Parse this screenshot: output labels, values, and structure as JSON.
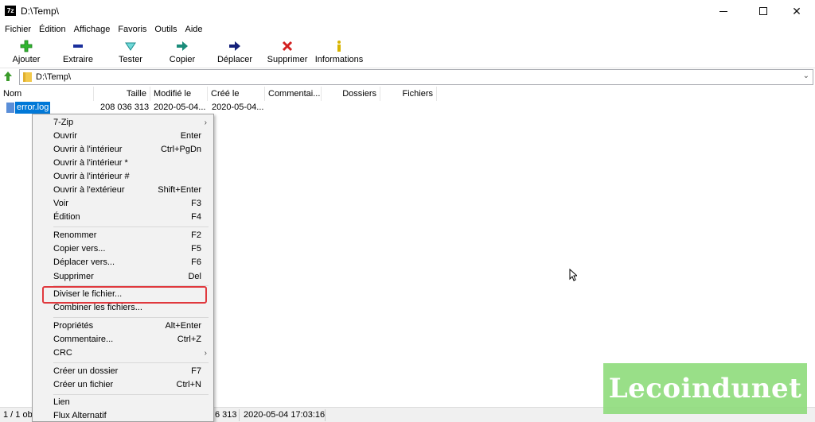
{
  "window": {
    "title": "D:\\Temp\\",
    "app_icon_text": "7z"
  },
  "menu": [
    "Fichier",
    "Édition",
    "Affichage",
    "Favoris",
    "Outils",
    "Aide"
  ],
  "toolbar": [
    {
      "label": "Ajouter",
      "icon": "add-icon",
      "color": "#2fb52f"
    },
    {
      "label": "Extraire",
      "icon": "extract-icon",
      "color": "#1a2f9c"
    },
    {
      "label": "Tester",
      "icon": "test-icon",
      "color": "#2fb5b5"
    },
    {
      "label": "Copier",
      "icon": "copy-icon",
      "color": "#1a8c7a"
    },
    {
      "label": "Déplacer",
      "icon": "move-icon",
      "color": "#14207a"
    },
    {
      "label": "Supprimer",
      "icon": "delete-icon",
      "color": "#d32020"
    },
    {
      "label": "Informations",
      "icon": "info-icon",
      "color": "#d8b400"
    }
  ],
  "address": {
    "path": "D:\\Temp\\"
  },
  "columns": [
    "Nom",
    "Taille",
    "Modifié le",
    "Créé le",
    "Commentai...",
    "Dossiers",
    "Fichiers"
  ],
  "files": [
    {
      "name": "error.log",
      "size": "208 036 313",
      "modified": "2020-05-04...",
      "created": "2020-05-04..."
    }
  ],
  "context_menu": {
    "items": [
      {
        "label": "7-Zip",
        "shortcut": "",
        "submenu": true
      },
      {
        "label": "Ouvrir",
        "shortcut": "Enter"
      },
      {
        "label": "Ouvrir à l'intérieur",
        "shortcut": "Ctrl+PgDn"
      },
      {
        "label": "Ouvrir à l'intérieur *",
        "shortcut": ""
      },
      {
        "label": "Ouvrir à l'intérieur #",
        "shortcut": ""
      },
      {
        "label": "Ouvrir à l'extérieur",
        "shortcut": "Shift+Enter"
      },
      {
        "label": "Voir",
        "shortcut": "F3"
      },
      {
        "label": "Édition",
        "shortcut": "F4"
      },
      {
        "label": "Renommer",
        "shortcut": "F2"
      },
      {
        "label": "Copier vers...",
        "shortcut": "F5"
      },
      {
        "label": "Déplacer vers...",
        "shortcut": "F6"
      },
      {
        "label": "Supprimer",
        "shortcut": "Del"
      },
      {
        "label": "Diviser le fichier...",
        "shortcut": ""
      },
      {
        "label": "Combiner les fichiers...",
        "shortcut": ""
      },
      {
        "label": "Propriétés",
        "shortcut": "Alt+Enter"
      },
      {
        "label": "Commentaire...",
        "shortcut": "Ctrl+Z"
      },
      {
        "label": "CRC",
        "shortcut": "",
        "submenu": true
      },
      {
        "label": "Créer un dossier",
        "shortcut": "F7"
      },
      {
        "label": "Créer un fichier",
        "shortcut": "Ctrl+N"
      },
      {
        "label": "Lien",
        "shortcut": ""
      },
      {
        "label": "Flux Alternatif",
        "shortcut": ""
      }
    ],
    "highlighted": "Diviser le fichier..."
  },
  "status": {
    "selection": "1 / 1 ob",
    "size": "6 313",
    "date": "2020-05-04 17:03:16"
  },
  "watermark": {
    "text": "Lecoindunet",
    "color": "#8fdc7c"
  }
}
